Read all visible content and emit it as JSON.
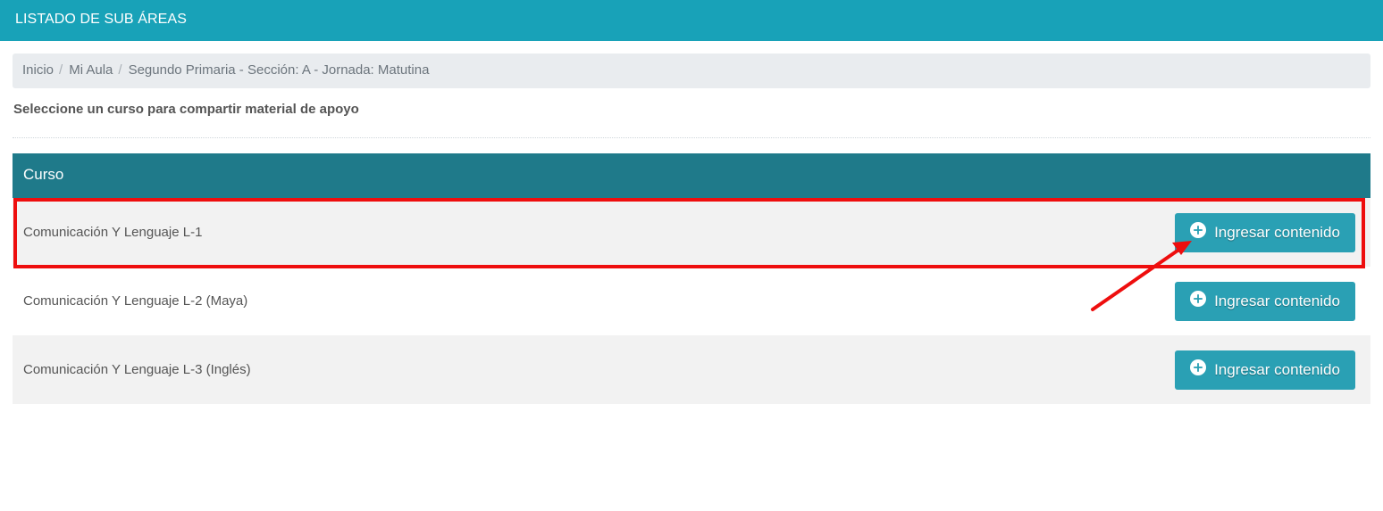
{
  "header": {
    "title": "LISTADO DE SUB ÁREAS"
  },
  "breadcrumb": {
    "items": [
      "Inicio",
      "Mi Aula",
      "Segundo Primaria - Sección: A - Jornada: Matutina"
    ],
    "separator": "/"
  },
  "instructions": "Seleccione un curso para compartir material de apoyo",
  "table": {
    "column_header": "Curso",
    "rows": [
      {
        "course": "Comunicación Y Lenguaje L-1",
        "action_label": "Ingresar contenido"
      },
      {
        "course": "Comunicación Y Lenguaje L-2 (Maya)",
        "action_label": "Ingresar contenido"
      },
      {
        "course": "Comunicación Y Lenguaje L-3 (Inglés)",
        "action_label": "Ingresar contenido"
      }
    ]
  },
  "icons": {
    "action_icon": "plus-circle-icon",
    "annotation_arrow": "red-arrow-icon"
  },
  "colors": {
    "header_bg": "#18a2b8",
    "table_header_bg": "#1f7a8a",
    "button_bg": "#2aa0b4",
    "highlight": "#ee0e0e"
  }
}
